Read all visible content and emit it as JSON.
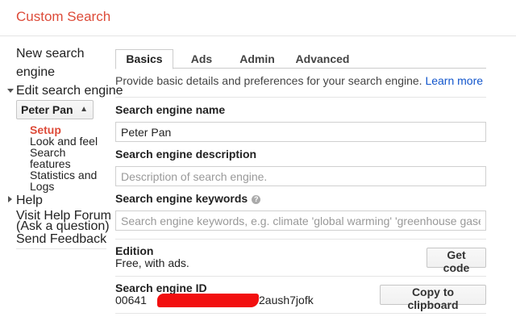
{
  "header": {
    "title": "Custom Search"
  },
  "sidebar": {
    "new_search_line1": "New search",
    "new_search_line2": "engine",
    "edit_engine": "Edit search engine",
    "engine_select": "Peter Pan",
    "sub_items": {
      "setup": "Setup",
      "look_feel": "Look and feel",
      "search_features_1": "Search",
      "search_features_2": "features",
      "statistics_1": "Statistics and",
      "statistics_2": "Logs"
    },
    "help": "Help",
    "forum_1": "Visit Help Forum",
    "forum_2": "(Ask a question)",
    "feedback": "Send Feedback"
  },
  "tabs": [
    "Basics",
    "Ads",
    "Admin",
    "Advanced"
  ],
  "main": {
    "intro": "Provide basic details and preferences for your search engine.",
    "learn_more": "Learn more",
    "name_label": "Search engine name",
    "name_value": "Peter Pan",
    "desc_label": "Search engine description",
    "desc_placeholder": "Description of search engine.",
    "keywords_label": "Search engine keywords",
    "keywords_placeholder": "Search engine keywords, e.g. climate 'global warming' 'greenhouse gases'",
    "edition_label": "Edition",
    "edition_value": "Free, with ads.",
    "get_code": "Get code",
    "id_label": "Search engine ID",
    "id_prefix": "00641",
    "id_suffix": "2aush7jofk",
    "copy_button": "Copy to clipboard"
  },
  "colors": {
    "brand": "#dd4b39",
    "link": "#1155cc",
    "redaction": "#f20f0f"
  }
}
